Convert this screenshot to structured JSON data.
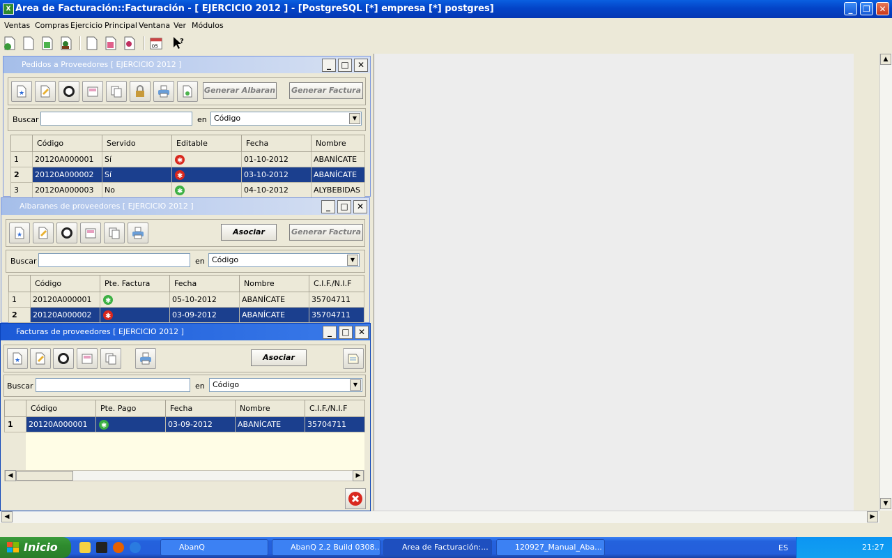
{
  "window": {
    "title": "Area de Facturación::Facturación  - [ EJERCICIO 2012 ] - [PostgreSQL [*] empresa [*] postgres]",
    "app_icon": "spreadsheet-icon",
    "controls": {
      "minimize": "_",
      "restore": "❐",
      "close": "✕"
    }
  },
  "menu": [
    "Ventas",
    "Compras",
    "Ejercicio",
    "Principal",
    "Ventana",
    "Ver",
    "Módulos"
  ],
  "subwindows": {
    "pedidos": {
      "title": "Pedidos a Proveedores [ EJERCICIO 2012 ]",
      "buttons": {
        "generar_albaran": "Generar Albaran",
        "generar_factura": "Generar Factura"
      },
      "search": {
        "label": "Buscar",
        "value": "",
        "en": "en",
        "field": "Código"
      },
      "columns": [
        "Código",
        "Servido",
        "Editable",
        "Fecha",
        "Nombre"
      ],
      "rows": [
        {
          "n": "1",
          "codigo": "20120A000001",
          "servido": "Sí",
          "editable": "no",
          "fecha": "01-10-2012",
          "nombre": "ABANÍCATE"
        },
        {
          "n": "2",
          "codigo": "20120A000002",
          "servido": "Sí",
          "editable": "no",
          "fecha": "03-10-2012",
          "nombre": "ABANÍCATE"
        },
        {
          "n": "3",
          "codigo": "20120A000003",
          "servido": "No",
          "editable": "yes",
          "fecha": "04-10-2012",
          "nombre": "ALYBEBIDAS"
        }
      ]
    },
    "albaranes": {
      "title": "Albaranes de proveedores [ EJERCICIO 2012 ]",
      "buttons": {
        "asociar": "Asociar",
        "generar_factura": "Generar Factura"
      },
      "search": {
        "label": "Buscar",
        "value": "",
        "en": "en",
        "field": "Código"
      },
      "columns": [
        "Código",
        "Pte. Factura",
        "Fecha",
        "Nombre",
        "C.I.F./N.I.F"
      ],
      "rows": [
        {
          "n": "1",
          "codigo": "20120A000001",
          "pte": "yes",
          "fecha": "05-10-2012",
          "nombre": "ABANÍCATE",
          "cif": "35704711"
        },
        {
          "n": "2",
          "codigo": "20120A000002",
          "pte": "no",
          "fecha": "03-09-2012",
          "nombre": "ABANÍCATE",
          "cif": "35704711"
        }
      ]
    },
    "facturas": {
      "title": "Facturas de proveedores [ EJERCICIO 2012 ]",
      "buttons": {
        "asociar": "Asociar"
      },
      "search": {
        "label": "Buscar",
        "value": "",
        "en": "en",
        "field": "Código"
      },
      "columns": [
        "Código",
        "Pte. Pago",
        "Fecha",
        "Nombre",
        "C.I.F./N.I.F"
      ],
      "rows": [
        {
          "n": "1",
          "codigo": "20120A000001",
          "pte": "yes",
          "fecha": "03-09-2012",
          "nombre": "ABANÍCATE",
          "cif": "35704711"
        }
      ]
    }
  },
  "taskbar": {
    "start": "Inicio",
    "tasks": [
      "AbanQ",
      "AbanQ 2.2 Build 0308...",
      "Area de Facturación:...",
      "120927_Manual_Aba..."
    ],
    "lang": "ES",
    "clock": "21:27"
  },
  "colors": {
    "selection": "#1b3f8e",
    "title_active": "#0a5fe0",
    "green_status": "#3cb043",
    "red_status": "#d9281e"
  }
}
